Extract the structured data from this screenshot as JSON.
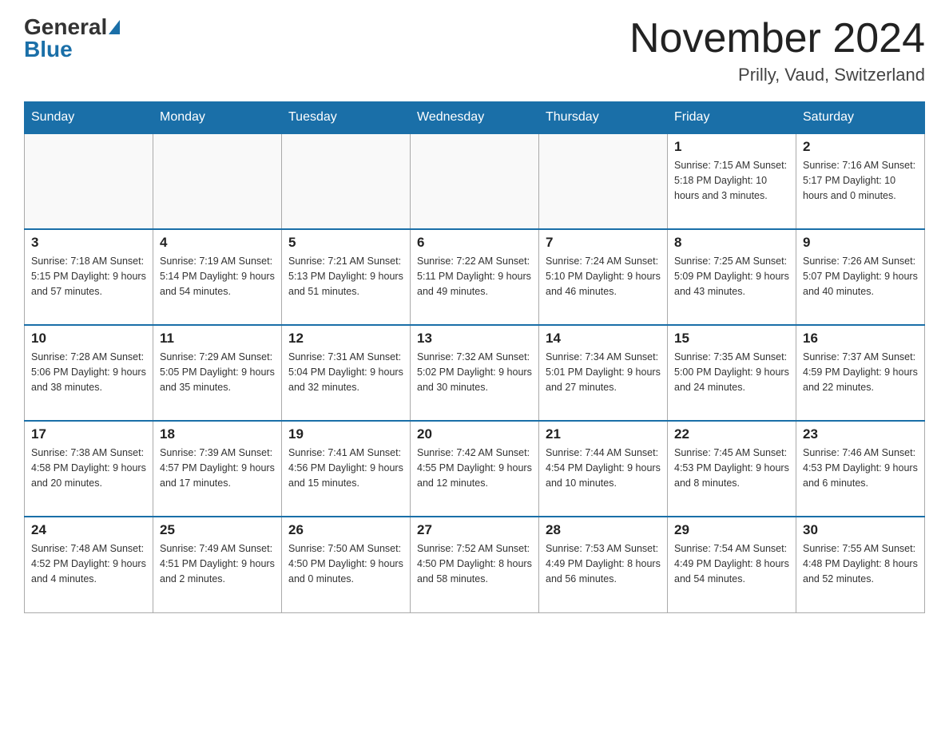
{
  "header": {
    "logo_general": "General",
    "logo_blue": "Blue",
    "month_title": "November 2024",
    "location": "Prilly, Vaud, Switzerland"
  },
  "days_of_week": [
    "Sunday",
    "Monday",
    "Tuesday",
    "Wednesday",
    "Thursday",
    "Friday",
    "Saturday"
  ],
  "weeks": [
    [
      {
        "day": "",
        "info": ""
      },
      {
        "day": "",
        "info": ""
      },
      {
        "day": "",
        "info": ""
      },
      {
        "day": "",
        "info": ""
      },
      {
        "day": "",
        "info": ""
      },
      {
        "day": "1",
        "info": "Sunrise: 7:15 AM\nSunset: 5:18 PM\nDaylight: 10 hours\nand 3 minutes."
      },
      {
        "day": "2",
        "info": "Sunrise: 7:16 AM\nSunset: 5:17 PM\nDaylight: 10 hours\nand 0 minutes."
      }
    ],
    [
      {
        "day": "3",
        "info": "Sunrise: 7:18 AM\nSunset: 5:15 PM\nDaylight: 9 hours\nand 57 minutes."
      },
      {
        "day": "4",
        "info": "Sunrise: 7:19 AM\nSunset: 5:14 PM\nDaylight: 9 hours\nand 54 minutes."
      },
      {
        "day": "5",
        "info": "Sunrise: 7:21 AM\nSunset: 5:13 PM\nDaylight: 9 hours\nand 51 minutes."
      },
      {
        "day": "6",
        "info": "Sunrise: 7:22 AM\nSunset: 5:11 PM\nDaylight: 9 hours\nand 49 minutes."
      },
      {
        "day": "7",
        "info": "Sunrise: 7:24 AM\nSunset: 5:10 PM\nDaylight: 9 hours\nand 46 minutes."
      },
      {
        "day": "8",
        "info": "Sunrise: 7:25 AM\nSunset: 5:09 PM\nDaylight: 9 hours\nand 43 minutes."
      },
      {
        "day": "9",
        "info": "Sunrise: 7:26 AM\nSunset: 5:07 PM\nDaylight: 9 hours\nand 40 minutes."
      }
    ],
    [
      {
        "day": "10",
        "info": "Sunrise: 7:28 AM\nSunset: 5:06 PM\nDaylight: 9 hours\nand 38 minutes."
      },
      {
        "day": "11",
        "info": "Sunrise: 7:29 AM\nSunset: 5:05 PM\nDaylight: 9 hours\nand 35 minutes."
      },
      {
        "day": "12",
        "info": "Sunrise: 7:31 AM\nSunset: 5:04 PM\nDaylight: 9 hours\nand 32 minutes."
      },
      {
        "day": "13",
        "info": "Sunrise: 7:32 AM\nSunset: 5:02 PM\nDaylight: 9 hours\nand 30 minutes."
      },
      {
        "day": "14",
        "info": "Sunrise: 7:34 AM\nSunset: 5:01 PM\nDaylight: 9 hours\nand 27 minutes."
      },
      {
        "day": "15",
        "info": "Sunrise: 7:35 AM\nSunset: 5:00 PM\nDaylight: 9 hours\nand 24 minutes."
      },
      {
        "day": "16",
        "info": "Sunrise: 7:37 AM\nSunset: 4:59 PM\nDaylight: 9 hours\nand 22 minutes."
      }
    ],
    [
      {
        "day": "17",
        "info": "Sunrise: 7:38 AM\nSunset: 4:58 PM\nDaylight: 9 hours\nand 20 minutes."
      },
      {
        "day": "18",
        "info": "Sunrise: 7:39 AM\nSunset: 4:57 PM\nDaylight: 9 hours\nand 17 minutes."
      },
      {
        "day": "19",
        "info": "Sunrise: 7:41 AM\nSunset: 4:56 PM\nDaylight: 9 hours\nand 15 minutes."
      },
      {
        "day": "20",
        "info": "Sunrise: 7:42 AM\nSunset: 4:55 PM\nDaylight: 9 hours\nand 12 minutes."
      },
      {
        "day": "21",
        "info": "Sunrise: 7:44 AM\nSunset: 4:54 PM\nDaylight: 9 hours\nand 10 minutes."
      },
      {
        "day": "22",
        "info": "Sunrise: 7:45 AM\nSunset: 4:53 PM\nDaylight: 9 hours\nand 8 minutes."
      },
      {
        "day": "23",
        "info": "Sunrise: 7:46 AM\nSunset: 4:53 PM\nDaylight: 9 hours\nand 6 minutes."
      }
    ],
    [
      {
        "day": "24",
        "info": "Sunrise: 7:48 AM\nSunset: 4:52 PM\nDaylight: 9 hours\nand 4 minutes."
      },
      {
        "day": "25",
        "info": "Sunrise: 7:49 AM\nSunset: 4:51 PM\nDaylight: 9 hours\nand 2 minutes."
      },
      {
        "day": "26",
        "info": "Sunrise: 7:50 AM\nSunset: 4:50 PM\nDaylight: 9 hours\nand 0 minutes."
      },
      {
        "day": "27",
        "info": "Sunrise: 7:52 AM\nSunset: 4:50 PM\nDaylight: 8 hours\nand 58 minutes."
      },
      {
        "day": "28",
        "info": "Sunrise: 7:53 AM\nSunset: 4:49 PM\nDaylight: 8 hours\nand 56 minutes."
      },
      {
        "day": "29",
        "info": "Sunrise: 7:54 AM\nSunset: 4:49 PM\nDaylight: 8 hours\nand 54 minutes."
      },
      {
        "day": "30",
        "info": "Sunrise: 7:55 AM\nSunset: 4:48 PM\nDaylight: 8 hours\nand 52 minutes."
      }
    ]
  ]
}
